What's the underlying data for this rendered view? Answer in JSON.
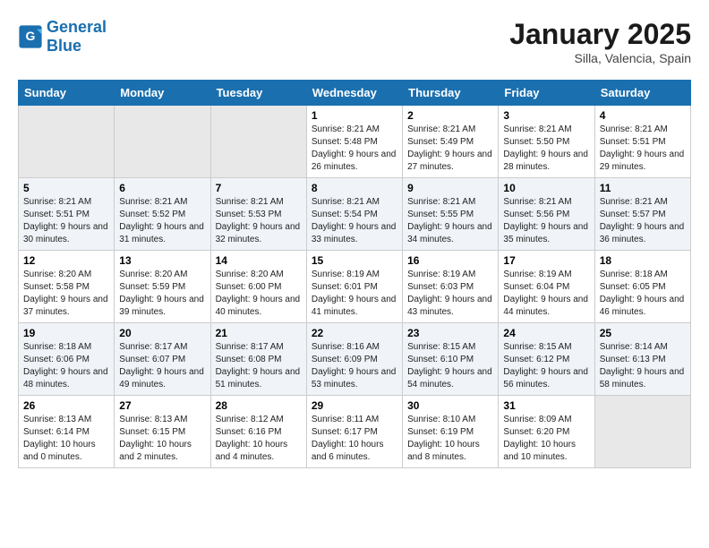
{
  "logo": {
    "text_general": "General",
    "text_blue": "Blue"
  },
  "title": "January 2025",
  "subtitle": "Silla, Valencia, Spain",
  "days_of_week": [
    "Sunday",
    "Monday",
    "Tuesday",
    "Wednesday",
    "Thursday",
    "Friday",
    "Saturday"
  ],
  "weeks": [
    [
      {
        "day": "",
        "sunrise": "",
        "sunset": "",
        "daylight": "",
        "empty": true
      },
      {
        "day": "",
        "sunrise": "",
        "sunset": "",
        "daylight": "",
        "empty": true
      },
      {
        "day": "",
        "sunrise": "",
        "sunset": "",
        "daylight": "",
        "empty": true
      },
      {
        "day": "1",
        "sunrise": "Sunrise: 8:21 AM",
        "sunset": "Sunset: 5:48 PM",
        "daylight": "Daylight: 9 hours and 26 minutes."
      },
      {
        "day": "2",
        "sunrise": "Sunrise: 8:21 AM",
        "sunset": "Sunset: 5:49 PM",
        "daylight": "Daylight: 9 hours and 27 minutes."
      },
      {
        "day": "3",
        "sunrise": "Sunrise: 8:21 AM",
        "sunset": "Sunset: 5:50 PM",
        "daylight": "Daylight: 9 hours and 28 minutes."
      },
      {
        "day": "4",
        "sunrise": "Sunrise: 8:21 AM",
        "sunset": "Sunset: 5:51 PM",
        "daylight": "Daylight: 9 hours and 29 minutes."
      }
    ],
    [
      {
        "day": "5",
        "sunrise": "Sunrise: 8:21 AM",
        "sunset": "Sunset: 5:51 PM",
        "daylight": "Daylight: 9 hours and 30 minutes."
      },
      {
        "day": "6",
        "sunrise": "Sunrise: 8:21 AM",
        "sunset": "Sunset: 5:52 PM",
        "daylight": "Daylight: 9 hours and 31 minutes."
      },
      {
        "day": "7",
        "sunrise": "Sunrise: 8:21 AM",
        "sunset": "Sunset: 5:53 PM",
        "daylight": "Daylight: 9 hours and 32 minutes."
      },
      {
        "day": "8",
        "sunrise": "Sunrise: 8:21 AM",
        "sunset": "Sunset: 5:54 PM",
        "daylight": "Daylight: 9 hours and 33 minutes."
      },
      {
        "day": "9",
        "sunrise": "Sunrise: 8:21 AM",
        "sunset": "Sunset: 5:55 PM",
        "daylight": "Daylight: 9 hours and 34 minutes."
      },
      {
        "day": "10",
        "sunrise": "Sunrise: 8:21 AM",
        "sunset": "Sunset: 5:56 PM",
        "daylight": "Daylight: 9 hours and 35 minutes."
      },
      {
        "day": "11",
        "sunrise": "Sunrise: 8:21 AM",
        "sunset": "Sunset: 5:57 PM",
        "daylight": "Daylight: 9 hours and 36 minutes."
      }
    ],
    [
      {
        "day": "12",
        "sunrise": "Sunrise: 8:20 AM",
        "sunset": "Sunset: 5:58 PM",
        "daylight": "Daylight: 9 hours and 37 minutes."
      },
      {
        "day": "13",
        "sunrise": "Sunrise: 8:20 AM",
        "sunset": "Sunset: 5:59 PM",
        "daylight": "Daylight: 9 hours and 39 minutes."
      },
      {
        "day": "14",
        "sunrise": "Sunrise: 8:20 AM",
        "sunset": "Sunset: 6:00 PM",
        "daylight": "Daylight: 9 hours and 40 minutes."
      },
      {
        "day": "15",
        "sunrise": "Sunrise: 8:19 AM",
        "sunset": "Sunset: 6:01 PM",
        "daylight": "Daylight: 9 hours and 41 minutes."
      },
      {
        "day": "16",
        "sunrise": "Sunrise: 8:19 AM",
        "sunset": "Sunset: 6:03 PM",
        "daylight": "Daylight: 9 hours and 43 minutes."
      },
      {
        "day": "17",
        "sunrise": "Sunrise: 8:19 AM",
        "sunset": "Sunset: 6:04 PM",
        "daylight": "Daylight: 9 hours and 44 minutes."
      },
      {
        "day": "18",
        "sunrise": "Sunrise: 8:18 AM",
        "sunset": "Sunset: 6:05 PM",
        "daylight": "Daylight: 9 hours and 46 minutes."
      }
    ],
    [
      {
        "day": "19",
        "sunrise": "Sunrise: 8:18 AM",
        "sunset": "Sunset: 6:06 PM",
        "daylight": "Daylight: 9 hours and 48 minutes."
      },
      {
        "day": "20",
        "sunrise": "Sunrise: 8:17 AM",
        "sunset": "Sunset: 6:07 PM",
        "daylight": "Daylight: 9 hours and 49 minutes."
      },
      {
        "day": "21",
        "sunrise": "Sunrise: 8:17 AM",
        "sunset": "Sunset: 6:08 PM",
        "daylight": "Daylight: 9 hours and 51 minutes."
      },
      {
        "day": "22",
        "sunrise": "Sunrise: 8:16 AM",
        "sunset": "Sunset: 6:09 PM",
        "daylight": "Daylight: 9 hours and 53 minutes."
      },
      {
        "day": "23",
        "sunrise": "Sunrise: 8:15 AM",
        "sunset": "Sunset: 6:10 PM",
        "daylight": "Daylight: 9 hours and 54 minutes."
      },
      {
        "day": "24",
        "sunrise": "Sunrise: 8:15 AM",
        "sunset": "Sunset: 6:12 PM",
        "daylight": "Daylight: 9 hours and 56 minutes."
      },
      {
        "day": "25",
        "sunrise": "Sunrise: 8:14 AM",
        "sunset": "Sunset: 6:13 PM",
        "daylight": "Daylight: 9 hours and 58 minutes."
      }
    ],
    [
      {
        "day": "26",
        "sunrise": "Sunrise: 8:13 AM",
        "sunset": "Sunset: 6:14 PM",
        "daylight": "Daylight: 10 hours and 0 minutes."
      },
      {
        "day": "27",
        "sunrise": "Sunrise: 8:13 AM",
        "sunset": "Sunset: 6:15 PM",
        "daylight": "Daylight: 10 hours and 2 minutes."
      },
      {
        "day": "28",
        "sunrise": "Sunrise: 8:12 AM",
        "sunset": "Sunset: 6:16 PM",
        "daylight": "Daylight: 10 hours and 4 minutes."
      },
      {
        "day": "29",
        "sunrise": "Sunrise: 8:11 AM",
        "sunset": "Sunset: 6:17 PM",
        "daylight": "Daylight: 10 hours and 6 minutes."
      },
      {
        "day": "30",
        "sunrise": "Sunrise: 8:10 AM",
        "sunset": "Sunset: 6:19 PM",
        "daylight": "Daylight: 10 hours and 8 minutes."
      },
      {
        "day": "31",
        "sunrise": "Sunrise: 8:09 AM",
        "sunset": "Sunset: 6:20 PM",
        "daylight": "Daylight: 10 hours and 10 minutes."
      },
      {
        "day": "",
        "sunrise": "",
        "sunset": "",
        "daylight": "",
        "empty": true
      }
    ]
  ]
}
